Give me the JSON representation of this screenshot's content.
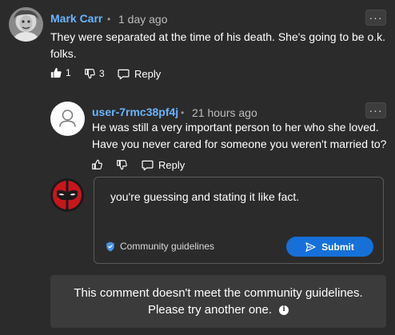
{
  "comments": [
    {
      "author": "Mark Carr",
      "separator": "•",
      "time": "1 day ago",
      "text_line1": "They were separated at the time of his death.  She's going to be o.k.",
      "text_line2": "folks.",
      "likes": "1",
      "dislikes": "3",
      "reply_label": "Reply",
      "more_label": "···"
    },
    {
      "author": "user-7rmc38pf4j",
      "separator": "•",
      "time": "21 hours ago",
      "text_line1": "He was still a very important person to her who she loved.",
      "text_line2": "Have you never cared for someone you weren't married to?",
      "reply_label": "Reply",
      "more_label": "···"
    }
  ],
  "reply_box": {
    "text": "you're guessing and stating it like fact.",
    "guidelines_label": "Community guidelines",
    "submit_label": "Submit"
  },
  "notice": {
    "line1": "This comment doesn't meet the community guidelines.",
    "line2": "Please try another one.",
    "info_glyph": "i"
  },
  "colors": {
    "background": "#2b2b2b",
    "author_link": "#6ab4ff",
    "submit": "#1670d8",
    "notice_bg": "#3b3b3b"
  }
}
